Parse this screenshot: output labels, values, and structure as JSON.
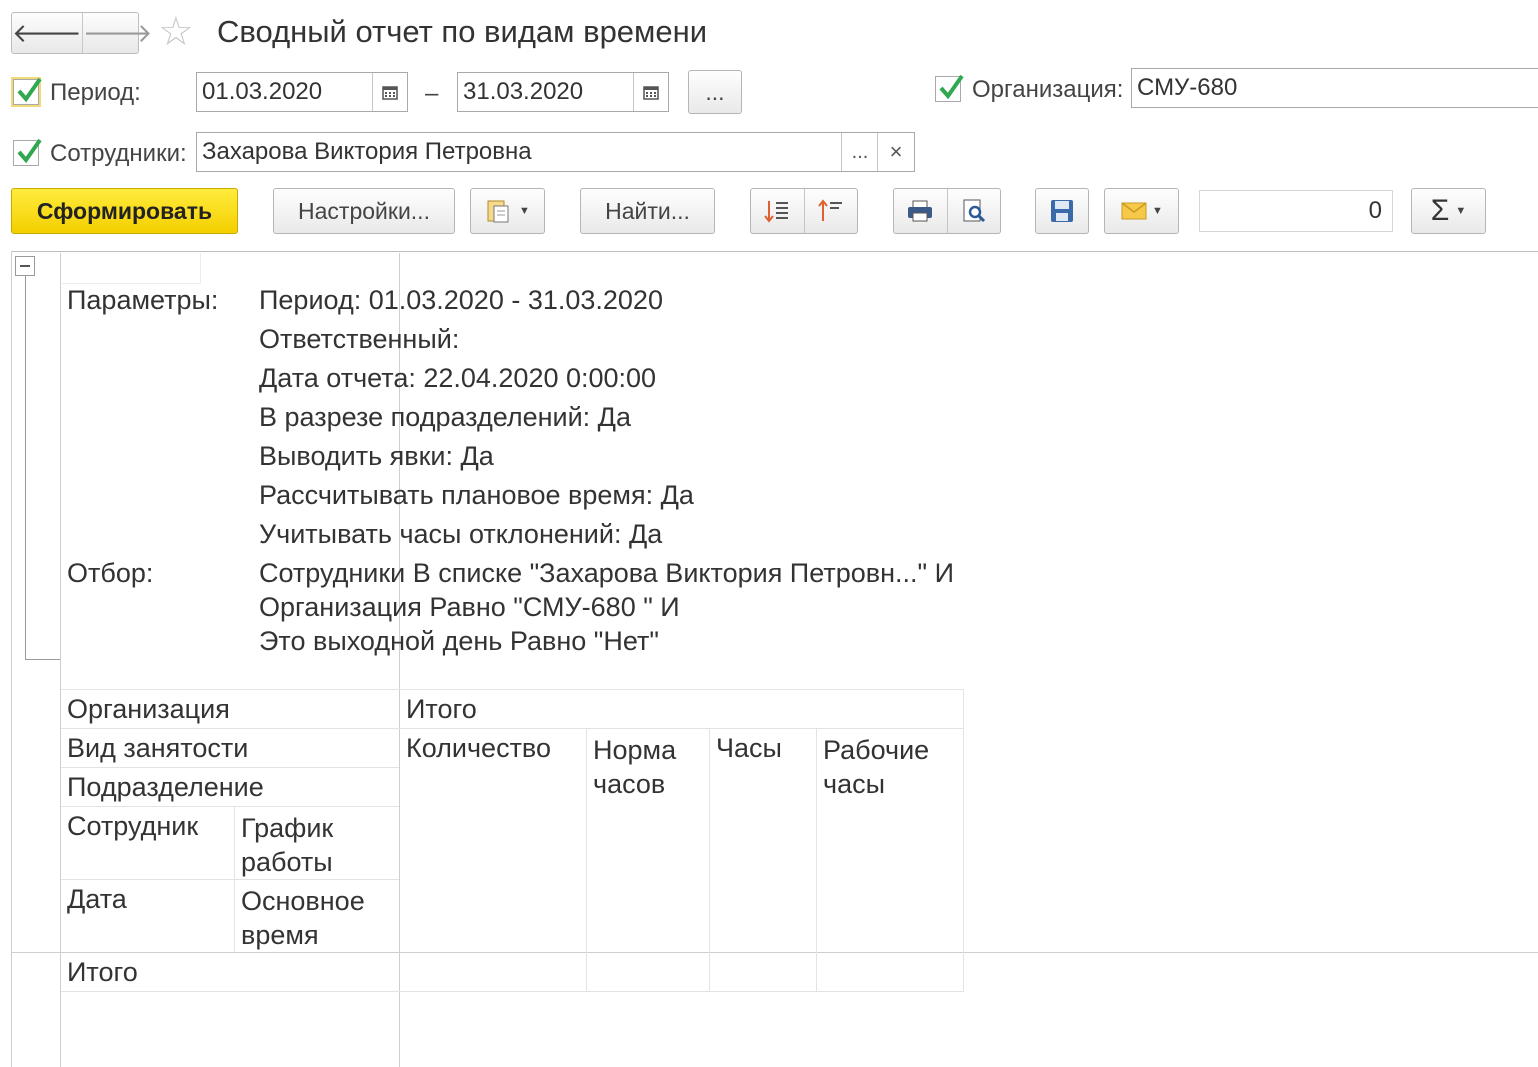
{
  "window": {
    "title": "Сводный отчет по видам времени"
  },
  "nav": {
    "back": "🡐",
    "forward": "🡒"
  },
  "filters": {
    "period_label": "Период:",
    "period_from": "01.03.2020",
    "period_to": "31.03.2020",
    "period_dash": "–",
    "period_more": "...",
    "org_label": "Организация:",
    "org_value": "СМУ-680",
    "employees_label": "Сотрудники:",
    "employees_value": "Захарова Виктория Петровна",
    "employees_more": "...",
    "employees_clear": "×"
  },
  "toolbar": {
    "generate": "Сформировать",
    "settings": "Настройки...",
    "find": "Найти...",
    "sum_value": "0",
    "sum_symbol": "Σ"
  },
  "report": {
    "params_label": "Параметры:",
    "params": [
      "Период: 01.03.2020 - 31.03.2020",
      "Ответственный:",
      "Дата отчета: 22.04.2020 0:00:00",
      "В разрезе подразделений: Да",
      "Выводить явки: Да",
      "Рассчитывать плановое время: Да",
      "Учитывать часы отклонений: Да"
    ],
    "filter_label": "Отбор:",
    "filter_lines": [
      "Сотрудники В списке \"Захарова Виктория Петровн...\" И",
      "Организация Равно \"СМУ-680 \" И",
      "Это выходной день Равно \"Нет\""
    ],
    "row_headers": {
      "org": "Организация",
      "employment": "Вид занятости",
      "department": "Подразделение",
      "employee": "Сотрудник",
      "schedule": "График работы",
      "date": "Дата",
      "base_time": "Основное время"
    },
    "col_headers": {
      "total": "Итого",
      "qty": "Количество",
      "norm": "Норма часов",
      "hours": "Часы",
      "work_hours": "Рабочие часы"
    },
    "total_row": "Итого"
  }
}
